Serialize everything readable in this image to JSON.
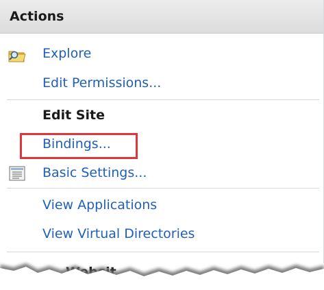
{
  "header": {
    "title": "Actions"
  },
  "actions": {
    "explore": "Explore",
    "edit_permissions": "Edit Permissions...",
    "section_edit_site": "Edit Site",
    "bindings": "Bindings...",
    "basic_settings": "Basic Settings...",
    "view_applications": "View Applications",
    "view_virtual_directories": "View Virtual Directories",
    "partial_website_label": "Websit"
  },
  "colors": {
    "link": "#1f5fb9",
    "highlight": "#e0353a",
    "header_bg": "#dcdcdc"
  },
  "icons": {
    "explore": "folder-search-icon",
    "basic_settings": "settings-list-icon"
  }
}
